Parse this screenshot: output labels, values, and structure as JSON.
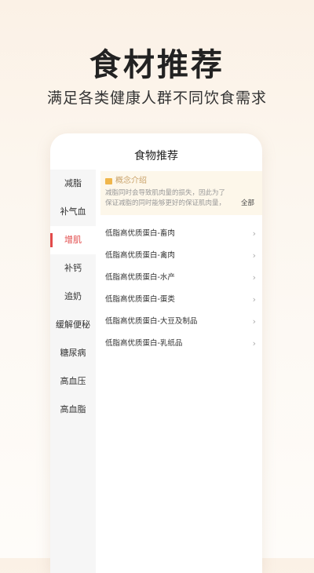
{
  "hero": {
    "title": "食材推荐",
    "subtitle": "满足各类健康人群不同饮食需求"
  },
  "screen": {
    "title": "食物推荐"
  },
  "sidebar": {
    "items": [
      {
        "label": "减脂"
      },
      {
        "label": "补气血"
      },
      {
        "label": "增肌",
        "active": true
      },
      {
        "label": "补钙"
      },
      {
        "label": "追奶"
      },
      {
        "label": "缓解便秘"
      },
      {
        "label": "糖尿病"
      },
      {
        "label": "高血压"
      },
      {
        "label": "高血脂"
      }
    ]
  },
  "intro": {
    "title": "概念介绍",
    "text": "减脂同时会导致肌肉量的损失，因此为了保证减脂的同时能够更好的保证肌肉量，我们…",
    "more": "全部",
    "icon": "book-icon"
  },
  "list": [
    {
      "label": "低脂高优质蛋白-畜肉"
    },
    {
      "label": "低脂高优质蛋白-禽肉"
    },
    {
      "label": "低脂高优质蛋白-水产"
    },
    {
      "label": "低脂高优质蛋白-蛋类"
    },
    {
      "label": "低脂高优质蛋白-大豆及制品"
    },
    {
      "label": "低脂高优质蛋白-乳纸品"
    }
  ],
  "colors": {
    "accent": "#e24a4a",
    "intro_bg": "#fdf7ea",
    "intro_title": "#c9a26a"
  }
}
